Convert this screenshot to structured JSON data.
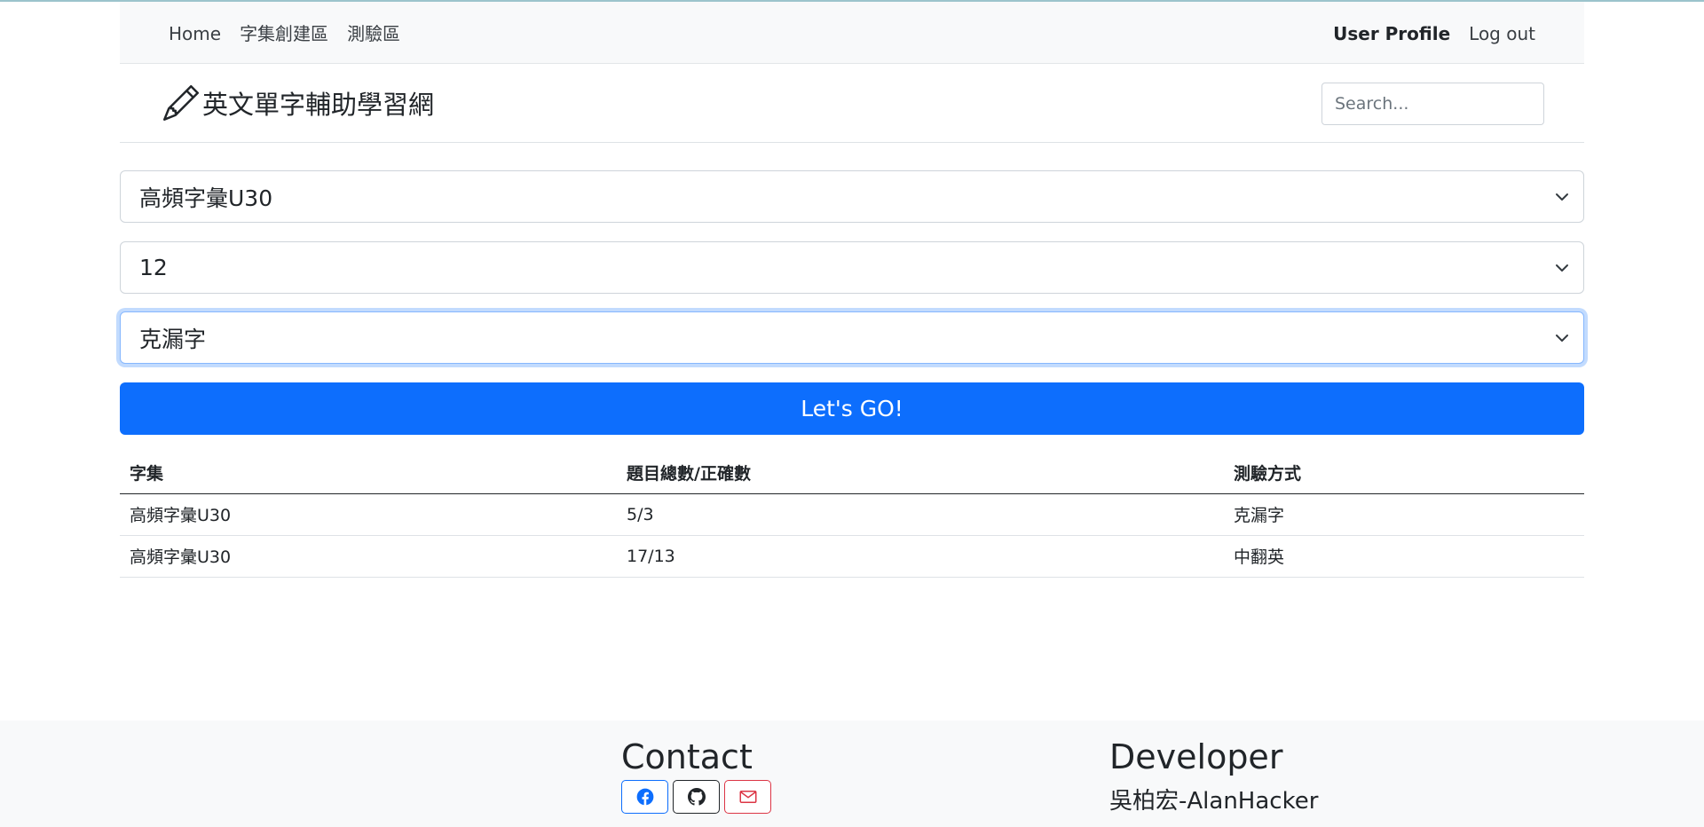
{
  "nav": {
    "left": [
      "Home",
      "字集創建區",
      "測驗區"
    ],
    "user_profile": "User Profile",
    "logout": "Log out"
  },
  "header": {
    "brand_title": "英文單字輔助學習網",
    "search_placeholder": "Search..."
  },
  "form": {
    "wordset_selected": "高頻字彙U30",
    "count_selected": "12",
    "mode_selected": "克漏字",
    "go_label": "Let's GO!"
  },
  "table": {
    "headers": [
      "字集",
      "題目總數/正確數",
      "測驗方式"
    ],
    "rows": [
      [
        "高頻字彙U30",
        "5/3",
        "克漏字"
      ],
      [
        "高頻字彙U30",
        "17/13",
        "中翻英"
      ]
    ]
  },
  "footer": {
    "contact_title": "Contact",
    "developer_title": "Developer",
    "developer_name": "吳柏宏-AlanHacker"
  },
  "colors": {
    "primary": "#0d6efd",
    "danger": "#dc3545",
    "navbar_bg": "#f8f9fa"
  },
  "icons": [
    "pencil-icon",
    "chevron-down-icon",
    "facebook-icon",
    "github-icon",
    "envelope-icon"
  ]
}
